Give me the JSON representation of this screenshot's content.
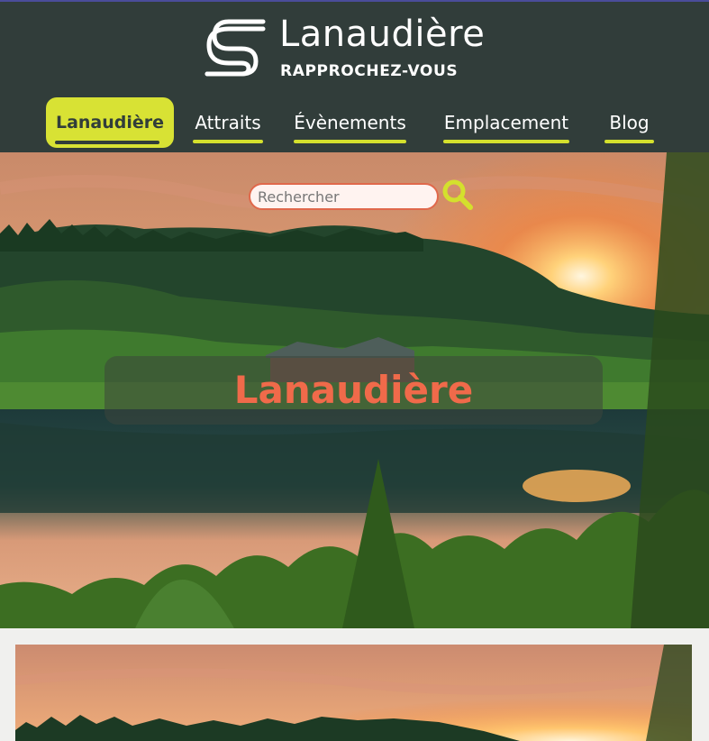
{
  "brand": {
    "name": "Lanaudière",
    "tagline": "RAPPROCHEZ-VOUS"
  },
  "nav": {
    "items": [
      {
        "label": "Lanaudière",
        "active": true
      },
      {
        "label": "Attraits",
        "active": false
      },
      {
        "label": "Évènements",
        "active": false
      },
      {
        "label": "Emplacement",
        "active": false
      },
      {
        "label": "Blog",
        "active": false
      }
    ]
  },
  "search": {
    "placeholder": "Rechercher",
    "value": "",
    "icon": "magnifier-icon"
  },
  "hero": {
    "title": "Lanaudière",
    "image": "lake-sunset-photo"
  },
  "card": {
    "image": "lake-sunset-photo"
  },
  "colors": {
    "header_bg": "#313d3a",
    "accent": "#d8e234",
    "title": "#f06a4a",
    "search_border": "#e0684b"
  }
}
